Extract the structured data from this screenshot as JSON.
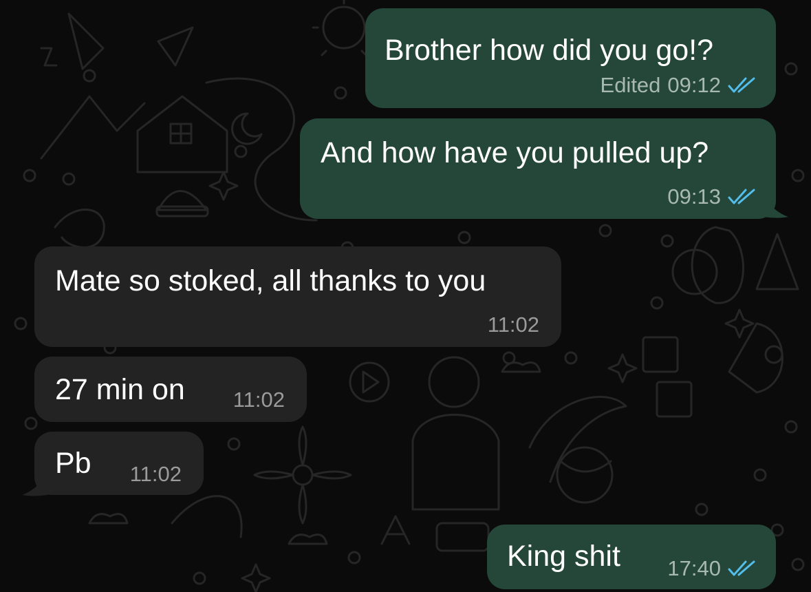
{
  "chat": {
    "messages": [
      {
        "direction": "outgoing",
        "text": "Brother how did you go!?",
        "edited_label": "Edited",
        "time": "09:12",
        "status_icon": "double-check-read-icon"
      },
      {
        "direction": "outgoing",
        "text": "And how have you pulled up?",
        "time": "09:13",
        "status_icon": "double-check-read-icon"
      },
      {
        "direction": "incoming",
        "text": "Mate so stoked, all thanks to you",
        "time": "11:02"
      },
      {
        "direction": "incoming",
        "text": "27 min on",
        "time": "11:02"
      },
      {
        "direction": "incoming",
        "text": "Pb",
        "time": "11:02"
      },
      {
        "direction": "outgoing",
        "text": "King shit",
        "time": "17:40",
        "status_icon": "double-check-read-icon"
      }
    ]
  },
  "colors": {
    "background": "#0b0b0b",
    "outgoing_bubble": "#25473a",
    "incoming_bubble": "#232323",
    "read_tick": "#53bdeb",
    "message_text": "#ffffff"
  }
}
